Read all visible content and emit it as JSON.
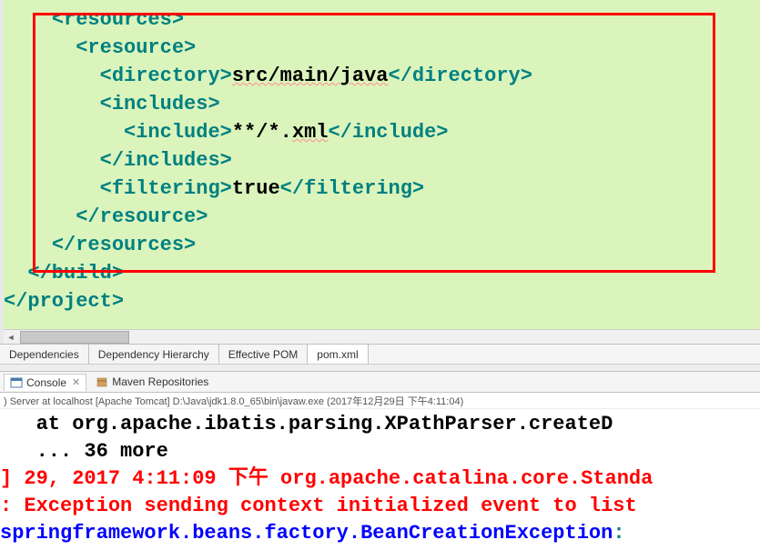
{
  "editor": {
    "lines": [
      {
        "indent": 4,
        "parts": [
          {
            "t": "tag",
            "v": "<resources>"
          }
        ]
      },
      {
        "indent": 6,
        "parts": [
          {
            "t": "tag",
            "v": "<resource>"
          }
        ]
      },
      {
        "indent": 8,
        "parts": [
          {
            "t": "tag",
            "v": "<directory>"
          },
          {
            "t": "txtw",
            "v": "src/main/java"
          },
          {
            "t": "tag",
            "v": "</directory>"
          }
        ]
      },
      {
        "indent": 8,
        "parts": [
          {
            "t": "tag",
            "v": "<includes>"
          }
        ]
      },
      {
        "indent": 10,
        "parts": [
          {
            "t": "tag",
            "v": "<include>"
          },
          {
            "t": "txt",
            "v": "**/*."
          },
          {
            "t": "txtw",
            "v": "xml"
          },
          {
            "t": "tag",
            "v": "</include>"
          }
        ]
      },
      {
        "indent": 8,
        "parts": [
          {
            "t": "tag",
            "v": "</includes>"
          }
        ]
      },
      {
        "indent": 8,
        "parts": [
          {
            "t": "tag",
            "v": "<filtering>"
          },
          {
            "t": "txt",
            "v": "true"
          },
          {
            "t": "tag",
            "v": "</filtering>"
          }
        ]
      },
      {
        "indent": 6,
        "parts": [
          {
            "t": "tag",
            "v": "</resource>"
          }
        ]
      },
      {
        "indent": 4,
        "parts": [
          {
            "t": "tag",
            "v": "</resources>"
          }
        ]
      },
      {
        "indent": 2,
        "parts": [
          {
            "t": "tag",
            "v": "</build>"
          }
        ]
      },
      {
        "indent": 0,
        "parts": []
      },
      {
        "indent": 0,
        "parts": [
          {
            "t": "tag",
            "v": "</project>"
          }
        ]
      }
    ]
  },
  "tabs": {
    "items": [
      "Dependencies",
      "Dependency Hierarchy",
      "Effective POM",
      "pom.xml"
    ],
    "active": 3
  },
  "views": {
    "console_label": "Console",
    "maven_label": "Maven Repositories"
  },
  "console": {
    "desc": ") Server at localhost [Apache Tomcat] D:\\Java\\jdk1.8.0_65\\bin\\javaw.exe (2017年12月29日 下午4:11:04)",
    "lines": [
      {
        "spans": [
          {
            "c": "c-black",
            "v": "   at org.apache.ibatis.parsing.XPathParser.createD"
          }
        ]
      },
      {
        "spans": [
          {
            "c": "c-black",
            "v": "   ... 36 more"
          }
        ]
      },
      {
        "spans": [
          {
            "c": "c-red",
            "v": "] 29, 2017 4:11:09 下午 org.apache.catalina.core.Standa"
          }
        ]
      },
      {
        "spans": [
          {
            "c": "c-red",
            "v": ": Exception sending context initialized event to list"
          }
        ]
      },
      {
        "spans": [
          {
            "c": "c-blue",
            "v": "springframework.beans.factory.BeanCreationException"
          },
          {
            "c": "c-teal",
            "v": ":"
          }
        ]
      }
    ]
  }
}
